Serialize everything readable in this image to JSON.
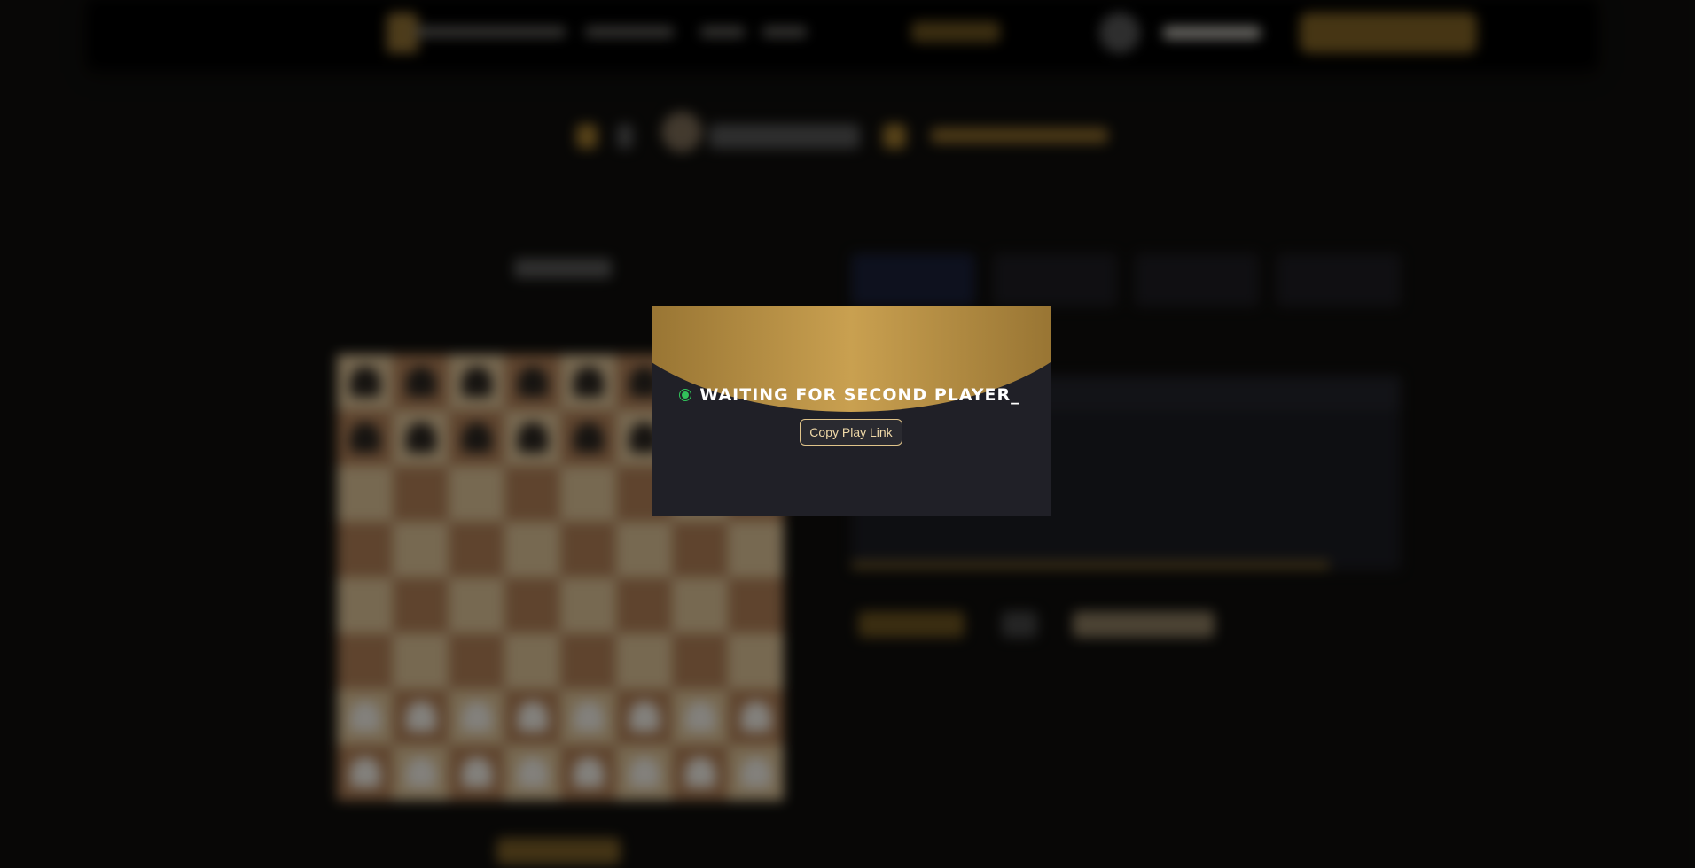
{
  "modal": {
    "status_text": "Waiting for second player_",
    "status_color": "#31c25a",
    "copy_button_label": "Copy Play Link",
    "accent": "#c9a050"
  },
  "background": {
    "board_light": "#d9bf94",
    "board_dark": "#ad7d55",
    "blurred": true
  }
}
